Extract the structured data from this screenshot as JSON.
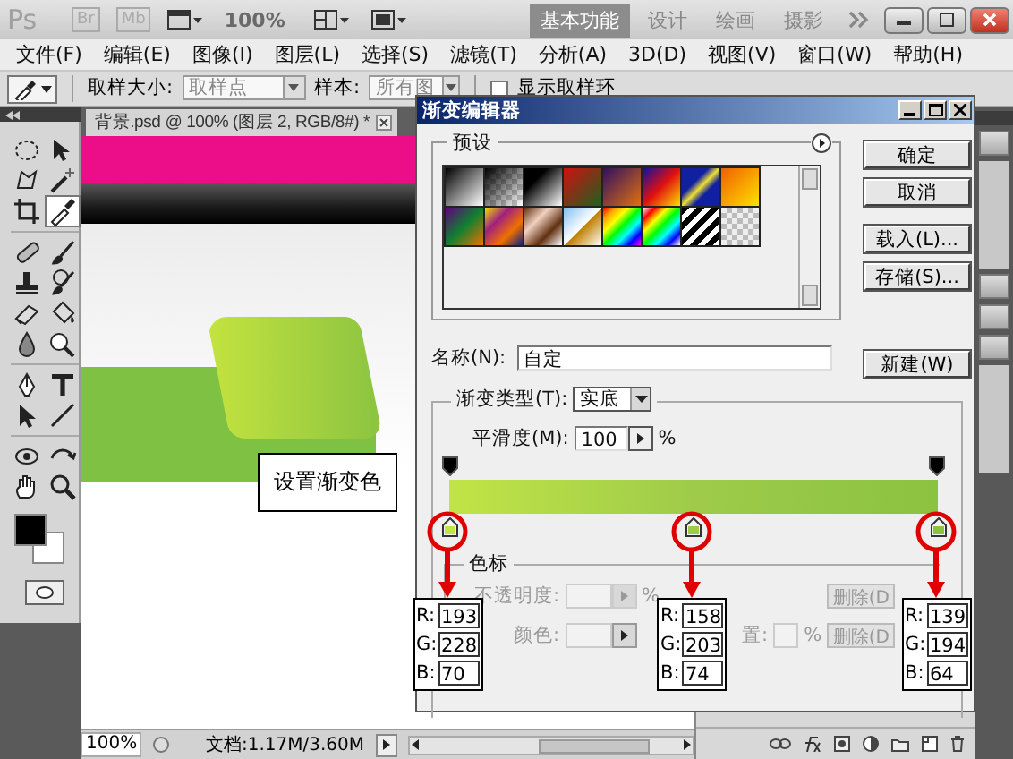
{
  "app_bar": {
    "logo": "Ps",
    "bridge": "Br",
    "mini_bridge": "Mb",
    "zoom": "100%",
    "workspaces": [
      {
        "label": "基本功能",
        "selected": true
      },
      {
        "label": "设计",
        "selected": false
      },
      {
        "label": "绘画",
        "selected": false
      },
      {
        "label": "摄影",
        "selected": false
      }
    ]
  },
  "menu": [
    "文件(F)",
    "编辑(E)",
    "图像(I)",
    "图层(L)",
    "选择(S)",
    "滤镜(T)",
    "分析(A)",
    "3D(D)",
    "视图(V)",
    "窗口(W)",
    "帮助(H)"
  ],
  "options_bar": {
    "sample_size_label": "取样大小:",
    "sample_size": "取样点",
    "sample_label": "样本:",
    "sample": "所有图",
    "show_ring": {
      "label": "显示取样环",
      "checked": false
    }
  },
  "toolbox": {
    "tools": [
      {
        "selected": false
      },
      {
        "selected": false
      },
      {
        "selected": false
      },
      {
        "selected": false
      },
      {
        "selected": false
      },
      {
        "selected": true
      },
      {
        "selected": false
      },
      {
        "selected": false
      },
      {
        "selected": false
      },
      {
        "selected": false
      },
      {
        "selected": false
      },
      {
        "selected": false
      },
      {
        "selected": false
      },
      {
        "selected": false
      },
      {
        "selected": false
      },
      {
        "selected": false
      },
      {
        "selected": false
      },
      {
        "selected": false
      },
      {
        "selected": false
      },
      {
        "selected": false
      },
      {
        "selected": false
      },
      {
        "selected": false
      }
    ]
  },
  "document": {
    "tab": "背景.psd @ 100% (图层 2, RGB/8#) *",
    "note": "设置渐变色",
    "zoom": "100%",
    "doc_size": "文档:1.17M/3.60M"
  },
  "dialog": {
    "title": "渐变编辑器",
    "presets_label": "预设",
    "buttons": [
      "确定",
      "取消",
      "载入(L)...",
      "存储(S)..."
    ],
    "name_label": "名称(N):",
    "name": "自定",
    "new_button": "新建(W)",
    "type_label": "渐变类型(T):",
    "type": "实底",
    "smoothness_label": "平滑度(M):",
    "smoothness": "100",
    "percent": "%",
    "stops": [
      {
        "color": "#c1e446",
        "channels": [
          {
            "label": "R:",
            "value": "193"
          },
          {
            "label": "G:",
            "value": "228"
          },
          {
            "label": "B:",
            "value": "70"
          }
        ]
      },
      {
        "color": "#9ecb4a",
        "channels": [
          {
            "label": "R:",
            "value": "158"
          },
          {
            "label": "G:",
            "value": "203"
          },
          {
            "label": "B:",
            "value": "74"
          }
        ]
      },
      {
        "color": "#8bc240",
        "channels": [
          {
            "label": "R:",
            "value": "139"
          },
          {
            "label": "G:",
            "value": "194"
          },
          {
            "label": "B:",
            "value": "64"
          }
        ]
      }
    ],
    "stop_group": {
      "label": "色标",
      "opacity_label": "不透明度:",
      "opacity_unit": "%",
      "color_label": "颜色:",
      "location_label": "置:",
      "location_unit": "%",
      "delete_buttons": [
        "删除(D",
        "删除(D"
      ],
      "disabled": true
    }
  }
}
